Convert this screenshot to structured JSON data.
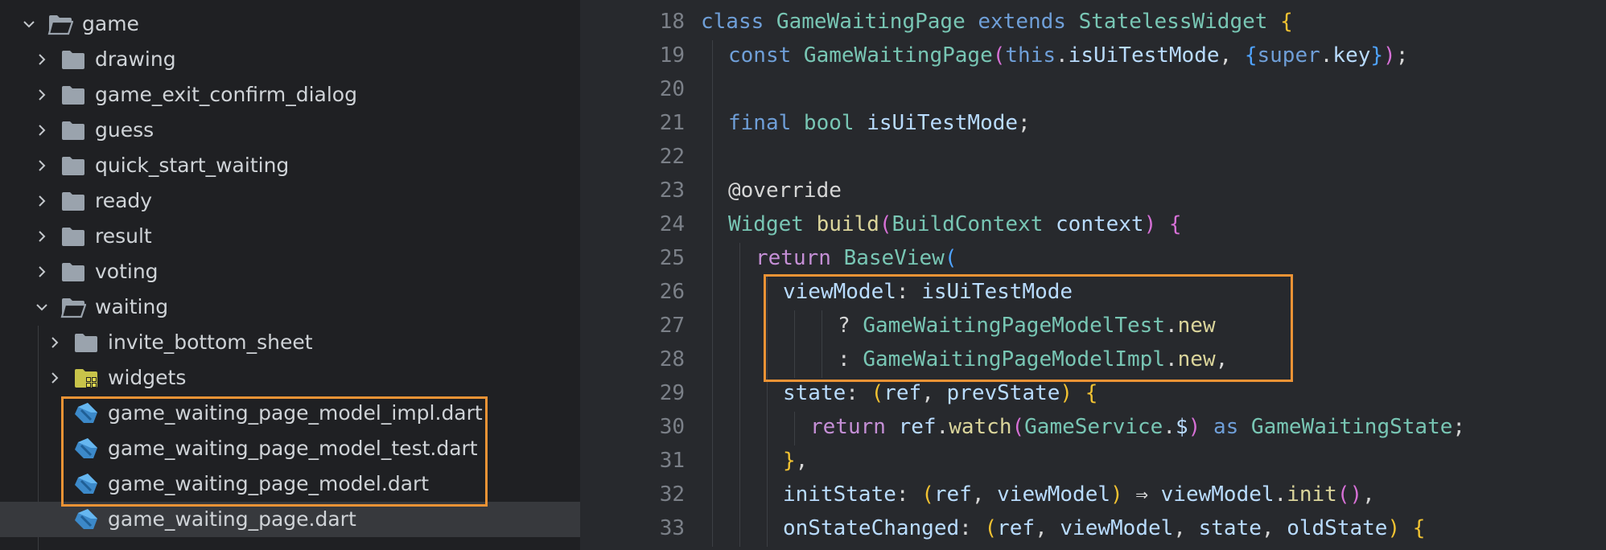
{
  "explorer": {
    "items": [
      {
        "label": "game",
        "type": "folder-open",
        "depth": 0
      },
      {
        "label": "drawing",
        "type": "folder",
        "depth": 1
      },
      {
        "label": "game_exit_confirm_dialog",
        "type": "folder",
        "depth": 1
      },
      {
        "label": "guess",
        "type": "folder",
        "depth": 1
      },
      {
        "label": "quick_start_waiting",
        "type": "folder",
        "depth": 1
      },
      {
        "label": "ready",
        "type": "folder",
        "depth": 1
      },
      {
        "label": "result",
        "type": "folder",
        "depth": 1
      },
      {
        "label": "voting",
        "type": "folder",
        "depth": 1
      },
      {
        "label": "waiting",
        "type": "folder-open",
        "depth": 1
      },
      {
        "label": "invite_bottom_sheet",
        "type": "folder",
        "depth": 2
      },
      {
        "label": "widgets",
        "type": "folder-widgets",
        "depth": 2
      },
      {
        "label": "game_waiting_page_model_impl.dart",
        "type": "dart",
        "depth": 2
      },
      {
        "label": "game_waiting_page_model_test.dart",
        "type": "dart",
        "depth": 2
      },
      {
        "label": "game_waiting_page_model.dart",
        "type": "dart",
        "depth": 2
      },
      {
        "label": "game_waiting_page.dart",
        "type": "dart",
        "depth": 2,
        "selected": true
      }
    ]
  },
  "editor": {
    "lines": [
      {
        "n": "18",
        "indent": 0,
        "tokens": [
          [
            "kw",
            "class "
          ],
          [
            "type",
            "GameWaitingPage "
          ],
          [
            "kw",
            "extends "
          ],
          [
            "type",
            "StatelessWidget "
          ],
          [
            "brace",
            "{"
          ]
        ]
      },
      {
        "n": "19",
        "indent": 1,
        "tokens": [
          [
            "kw",
            "const "
          ],
          [
            "type",
            "GameWaitingPage"
          ],
          [
            "brace2",
            "("
          ],
          [
            "kw",
            "this"
          ],
          [
            "default",
            "."
          ],
          [
            "var",
            "isUiTestMode"
          ],
          [
            "default",
            ", "
          ],
          [
            "brace3",
            "{"
          ],
          [
            "kw",
            "super"
          ],
          [
            "default",
            "."
          ],
          [
            "var",
            "key"
          ],
          [
            "brace3",
            "}"
          ],
          [
            "brace2",
            ")"
          ],
          [
            "default",
            ";"
          ]
        ]
      },
      {
        "n": "20",
        "indent": 1,
        "tokens": []
      },
      {
        "n": "21",
        "indent": 1,
        "tokens": [
          [
            "kw",
            "final "
          ],
          [
            "type",
            "bool "
          ],
          [
            "var",
            "isUiTestMode"
          ],
          [
            "default",
            ";"
          ]
        ]
      },
      {
        "n": "22",
        "indent": 1,
        "tokens": []
      },
      {
        "n": "23",
        "indent": 1,
        "tokens": [
          [
            "default",
            "@override"
          ]
        ]
      },
      {
        "n": "24",
        "indent": 1,
        "tokens": [
          [
            "type",
            "Widget "
          ],
          [
            "fn",
            "build"
          ],
          [
            "brace2",
            "("
          ],
          [
            "type",
            "BuildContext "
          ],
          [
            "var",
            "context"
          ],
          [
            "brace2",
            ")"
          ],
          [
            "default",
            " "
          ],
          [
            "brace2",
            "{"
          ]
        ]
      },
      {
        "n": "25",
        "indent": 2,
        "tokens": [
          [
            "ctrl",
            "return "
          ],
          [
            "type",
            "BaseView"
          ],
          [
            "brace3",
            "("
          ]
        ]
      },
      {
        "n": "26",
        "indent": 3,
        "tokens": [
          [
            "var",
            "viewModel"
          ],
          [
            "default",
            ": "
          ],
          [
            "var",
            "isUiTestMode"
          ]
        ]
      },
      {
        "n": "27",
        "indent": 5,
        "tokens": [
          [
            "default",
            "? "
          ],
          [
            "type",
            "GameWaitingPageModelTest"
          ],
          [
            "default",
            "."
          ],
          [
            "fn",
            "new"
          ]
        ]
      },
      {
        "n": "28",
        "indent": 5,
        "tokens": [
          [
            "default",
            ": "
          ],
          [
            "type",
            "GameWaitingPageModelImpl"
          ],
          [
            "default",
            "."
          ],
          [
            "fn",
            "new"
          ],
          [
            "default",
            ","
          ]
        ]
      },
      {
        "n": "29",
        "indent": 3,
        "tokens": [
          [
            "var",
            "state"
          ],
          [
            "default",
            ": "
          ],
          [
            "brace",
            "("
          ],
          [
            "var",
            "ref"
          ],
          [
            "default",
            ", "
          ],
          [
            "var",
            "prevState"
          ],
          [
            "brace",
            ")"
          ],
          [
            "default",
            " "
          ],
          [
            "brace",
            "{"
          ]
        ]
      },
      {
        "n": "30",
        "indent": 4,
        "tokens": [
          [
            "ctrl",
            "return "
          ],
          [
            "var",
            "ref"
          ],
          [
            "default",
            "."
          ],
          [
            "fn",
            "watch"
          ],
          [
            "brace2",
            "("
          ],
          [
            "type",
            "GameService"
          ],
          [
            "default",
            "."
          ],
          [
            "var",
            "$"
          ],
          [
            "brace2",
            ")"
          ],
          [
            "kw",
            " as "
          ],
          [
            "type",
            "GameWaitingState"
          ],
          [
            "default",
            ";"
          ]
        ]
      },
      {
        "n": "31",
        "indent": 3,
        "tokens": [
          [
            "brace",
            "}"
          ],
          [
            "default",
            ","
          ]
        ]
      },
      {
        "n": "32",
        "indent": 3,
        "tokens": [
          [
            "var",
            "initState"
          ],
          [
            "default",
            ": "
          ],
          [
            "brace",
            "("
          ],
          [
            "var",
            "ref"
          ],
          [
            "default",
            ", "
          ],
          [
            "var",
            "viewModel"
          ],
          [
            "brace",
            ")"
          ],
          [
            "default",
            " ⇒ "
          ],
          [
            "var",
            "viewModel"
          ],
          [
            "default",
            "."
          ],
          [
            "fn",
            "init"
          ],
          [
            "brace2",
            "()"
          ],
          [
            "default",
            ","
          ]
        ]
      },
      {
        "n": "33",
        "indent": 3,
        "tokens": [
          [
            "var",
            "onStateChanged"
          ],
          [
            "default",
            ": "
          ],
          [
            "brace",
            "("
          ],
          [
            "var",
            "ref"
          ],
          [
            "default",
            ", "
          ],
          [
            "var",
            "viewModel"
          ],
          [
            "default",
            ", "
          ],
          [
            "var",
            "state"
          ],
          [
            "default",
            ", "
          ],
          [
            "var",
            "oldState"
          ],
          [
            "brace",
            ")"
          ],
          [
            "default",
            " "
          ],
          [
            "brace",
            "{"
          ]
        ]
      }
    ]
  },
  "colors": {
    "accent_highlight": "#ec9335",
    "folder": "#9aa3ad",
    "dart_icon": "#3c89c9",
    "widgets_folder": "#c8c44a"
  }
}
